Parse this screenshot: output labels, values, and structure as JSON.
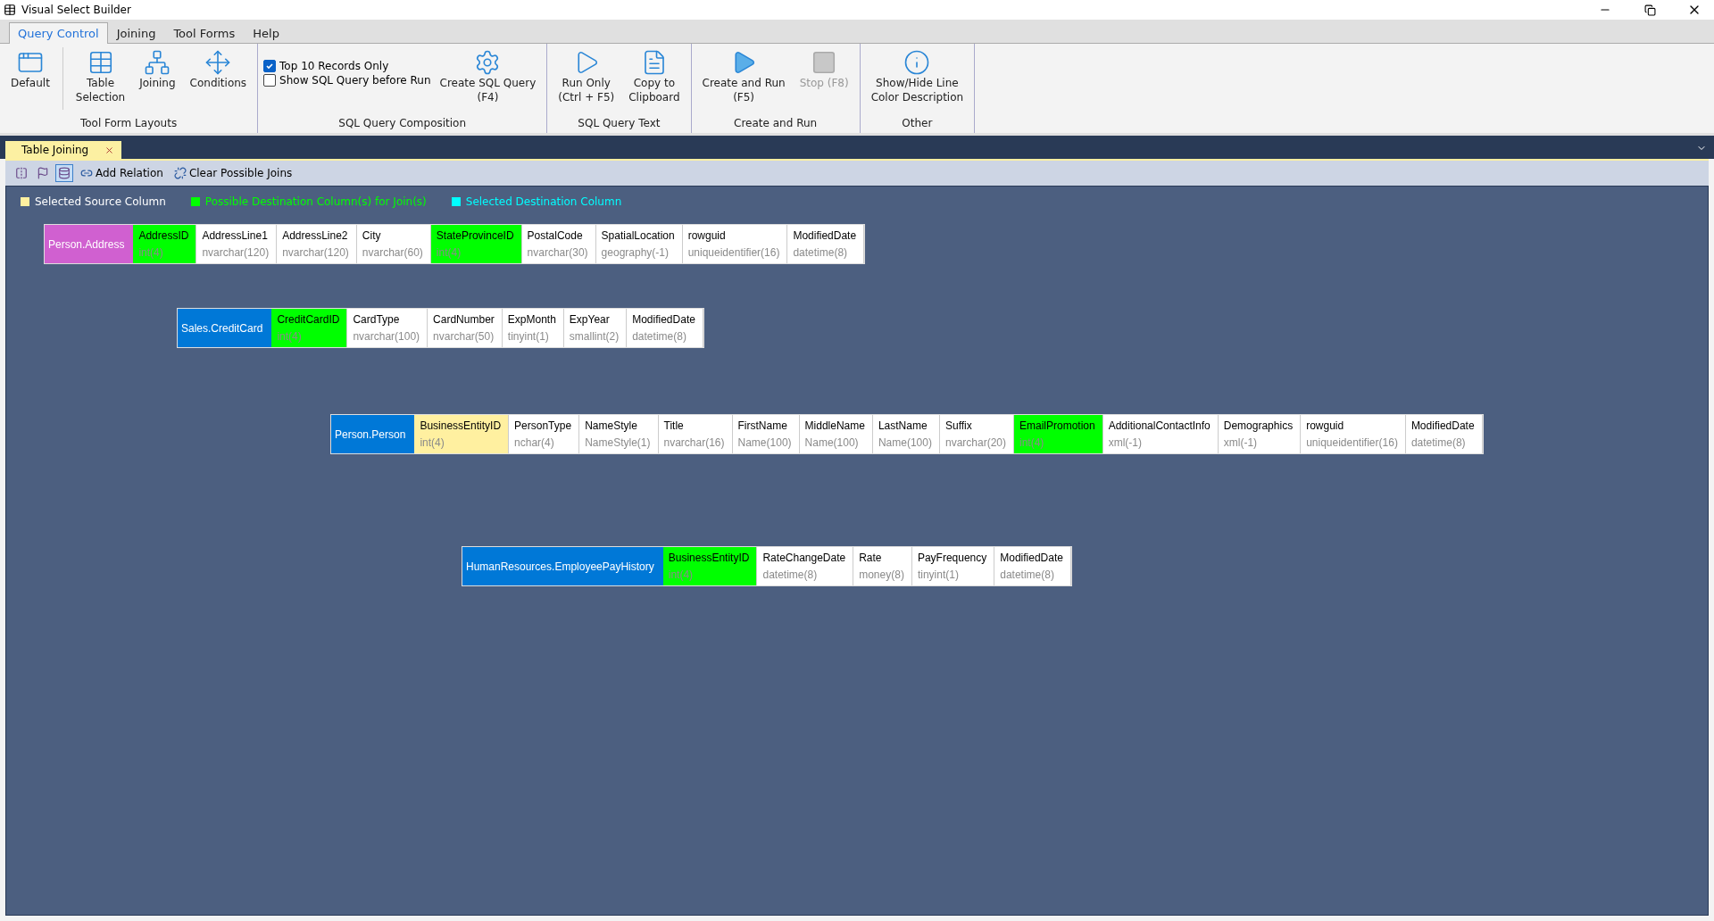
{
  "window": {
    "title": "Visual Select Builder"
  },
  "menu_tabs": [
    {
      "label": "Query Control",
      "selected": true
    },
    {
      "label": "Joining",
      "selected": false
    },
    {
      "label": "Tool Forms",
      "selected": false
    },
    {
      "label": "Help",
      "selected": false
    }
  ],
  "ribbon_groups": [
    {
      "title": "Tool Form Layouts",
      "items": [
        {
          "kind": "button",
          "label": "Default"
        },
        {
          "kind": "separator"
        },
        {
          "kind": "button",
          "label": "Table\nSelection"
        },
        {
          "kind": "button",
          "label": "Joining"
        },
        {
          "kind": "button",
          "label": "Conditions"
        }
      ]
    },
    {
      "title": "SQL Query Composition",
      "items": [
        {
          "kind": "checks",
          "checks": [
            {
              "label": "Top 10 Records Only",
              "checked": true
            },
            {
              "label": "Show SQL Query before Run",
              "checked": false
            }
          ]
        },
        {
          "kind": "button",
          "label": "Create SQL Query\n(F4)"
        }
      ]
    },
    {
      "title": "SQL Query Text",
      "items": [
        {
          "kind": "button",
          "label": "Run Only\n(Ctrl + F5)"
        },
        {
          "kind": "button",
          "label": "Copy to\nClipboard"
        }
      ]
    },
    {
      "title": "Create and Run",
      "items": [
        {
          "kind": "button",
          "label": "Create and Run\n(F5)"
        },
        {
          "kind": "button",
          "label": "Stop (F8)",
          "disabled": true
        }
      ]
    },
    {
      "title": "Other",
      "items": [
        {
          "kind": "button",
          "label": "Show/Hide Line\nColor Description"
        }
      ]
    }
  ],
  "document_tabs": [
    {
      "label": "Table Joining",
      "selected": true
    }
  ],
  "toolbar": [
    {
      "kind": "icon",
      "selected": false
    },
    {
      "kind": "icon",
      "selected": false
    },
    {
      "kind": "icon",
      "selected": true
    },
    {
      "kind": "text",
      "label": "Add Relation"
    },
    {
      "kind": "text",
      "label": "Clear Possible Joins"
    }
  ],
  "legend": [
    {
      "label": "Selected Source Column",
      "color": "#fff0a0"
    },
    {
      "label": "Possible Destination Column(s) for Join(s)",
      "color": "#00ff00"
    },
    {
      "label": "Selected Destination Column",
      "color": "#00ffff"
    }
  ],
  "tables": [
    {
      "name": "Person.Address",
      "color": "#d060d0",
      "columns": [
        {
          "name": "AddressID",
          "type": "int(4)",
          "kind": "possible"
        },
        {
          "name": "AddressLine1",
          "type": "nvarchar(120)",
          "kind": "plain"
        },
        {
          "name": "AddressLine2",
          "type": "nvarchar(120)",
          "kind": "plain"
        },
        {
          "name": "City",
          "type": "nvarchar(60)",
          "kind": "plain"
        },
        {
          "name": "StateProvinceID",
          "type": "int(4)",
          "kind": "possible"
        },
        {
          "name": "PostalCode",
          "type": "nvarchar(30)",
          "kind": "plain"
        },
        {
          "name": "SpatialLocation",
          "type": "geography(-1)",
          "kind": "plain"
        },
        {
          "name": "rowguid",
          "type": "uniqueidentifier(16)",
          "kind": "plain"
        },
        {
          "name": "ModifiedDate",
          "type": "datetime(8)",
          "kind": "plain"
        }
      ]
    },
    {
      "name": "Sales.CreditCard",
      "color": "#0078d7",
      "columns": [
        {
          "name": "CreditCardID",
          "type": "int(4)",
          "kind": "possible"
        },
        {
          "name": "CardType",
          "type": "nvarchar(100)",
          "kind": "plain"
        },
        {
          "name": "CardNumber",
          "type": "nvarchar(50)",
          "kind": "plain"
        },
        {
          "name": "ExpMonth",
          "type": "tinyint(1)",
          "kind": "plain"
        },
        {
          "name": "ExpYear",
          "type": "smallint(2)",
          "kind": "plain"
        },
        {
          "name": "ModifiedDate",
          "type": "datetime(8)",
          "kind": "plain"
        }
      ]
    },
    {
      "name": "Person.Person",
      "color": "#0078d7",
      "columns": [
        {
          "name": "BusinessEntityID",
          "type": "int(4)",
          "kind": "source"
        },
        {
          "name": "PersonType",
          "type": "nchar(4)",
          "kind": "plain"
        },
        {
          "name": "NameStyle",
          "type": "NameStyle(1)",
          "kind": "plain"
        },
        {
          "name": "Title",
          "type": "nvarchar(16)",
          "kind": "plain"
        },
        {
          "name": "FirstName",
          "type": "Name(100)",
          "kind": "plain"
        },
        {
          "name": "MiddleName",
          "type": "Name(100)",
          "kind": "plain"
        },
        {
          "name": "LastName",
          "type": "Name(100)",
          "kind": "plain"
        },
        {
          "name": "Suffix",
          "type": "nvarchar(20)",
          "kind": "plain"
        },
        {
          "name": "EmailPromotion",
          "type": "int(4)",
          "kind": "possible"
        },
        {
          "name": "AdditionalContactInfo",
          "type": "xml(-1)",
          "kind": "plain"
        },
        {
          "name": "Demographics",
          "type": "xml(-1)",
          "kind": "plain"
        },
        {
          "name": "rowguid",
          "type": "uniqueidentifier(16)",
          "kind": "plain"
        },
        {
          "name": "ModifiedDate",
          "type": "datetime(8)",
          "kind": "plain"
        }
      ]
    },
    {
      "name": "HumanResources.EmployeePayHistory",
      "color": "#0078d7",
      "columns": [
        {
          "name": "BusinessEntityID",
          "type": "int(4)",
          "kind": "possible"
        },
        {
          "name": "RateChangeDate",
          "type": "datetime(8)",
          "kind": "plain"
        },
        {
          "name": "Rate",
          "type": "money(8)",
          "kind": "plain"
        },
        {
          "name": "PayFrequency",
          "type": "tinyint(1)",
          "kind": "plain"
        },
        {
          "name": "ModifiedDate",
          "type": "datetime(8)",
          "kind": "plain"
        }
      ]
    }
  ]
}
